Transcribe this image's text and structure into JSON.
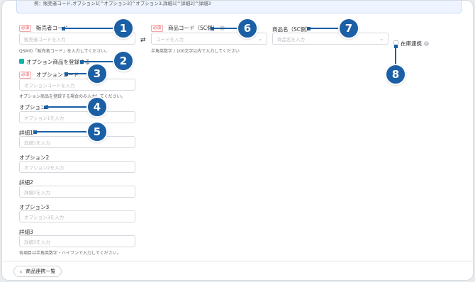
{
  "banner": {
    "example": "例：販売者コード,オプション1[^オプション2]^オプション3,詳細1[^詳細2]^詳細3"
  },
  "seller_code": {
    "required": "必須",
    "label": "販売者コード",
    "placeholder": "販売者コードを入力",
    "hint": "QSMの「販売者コード」を入力してください。"
  },
  "product_code": {
    "required": "必須",
    "label": "商品コード（SC側）",
    "placeholder": "コードを入力",
    "hint": "半角英数字 / 100文字以内で入力してください"
  },
  "product_name": {
    "label": "商品名（SC側）",
    "placeholder": "商品名を入力"
  },
  "stock_sync": {
    "label": "在庫連携"
  },
  "register_option": {
    "label": "オプション商品を登録する"
  },
  "option_code": {
    "required": "必須",
    "label": "オプションコード",
    "placeholder": "オプションコードを入力",
    "hint": "オプション商品を登録する場合のみ入力してください。"
  },
  "option1": {
    "label": "オプション1",
    "placeholder": "オプション1を入力"
  },
  "detail1": {
    "label": "詳細1",
    "placeholder": "詳細1を入力"
  },
  "option2": {
    "label": "オプション2",
    "placeholder": "オプション2を入力"
  },
  "detail2": {
    "label": "詳細2",
    "placeholder": "詳細2を入力"
  },
  "option3": {
    "label": "オプション3",
    "placeholder": "オプション3を入力"
  },
  "detail3": {
    "label": "詳細3",
    "placeholder": "詳細3を入力"
  },
  "footnote": "各項目は半角英数字・ハイフンで入力してください。",
  "back_button": "商品連携一覧",
  "callouts": [
    "1",
    "2",
    "3",
    "4",
    "5",
    "6",
    "7",
    "8"
  ],
  "icons": {
    "swap": "swap-arrows-icon",
    "back": "chevron-left-icon",
    "dropdown": "chevron-down-icon",
    "help": "question-circle-icon"
  },
  "colors": {
    "accent": "#1b5fa5",
    "required": "#e5484d",
    "checkbox": "#12b3a8"
  }
}
